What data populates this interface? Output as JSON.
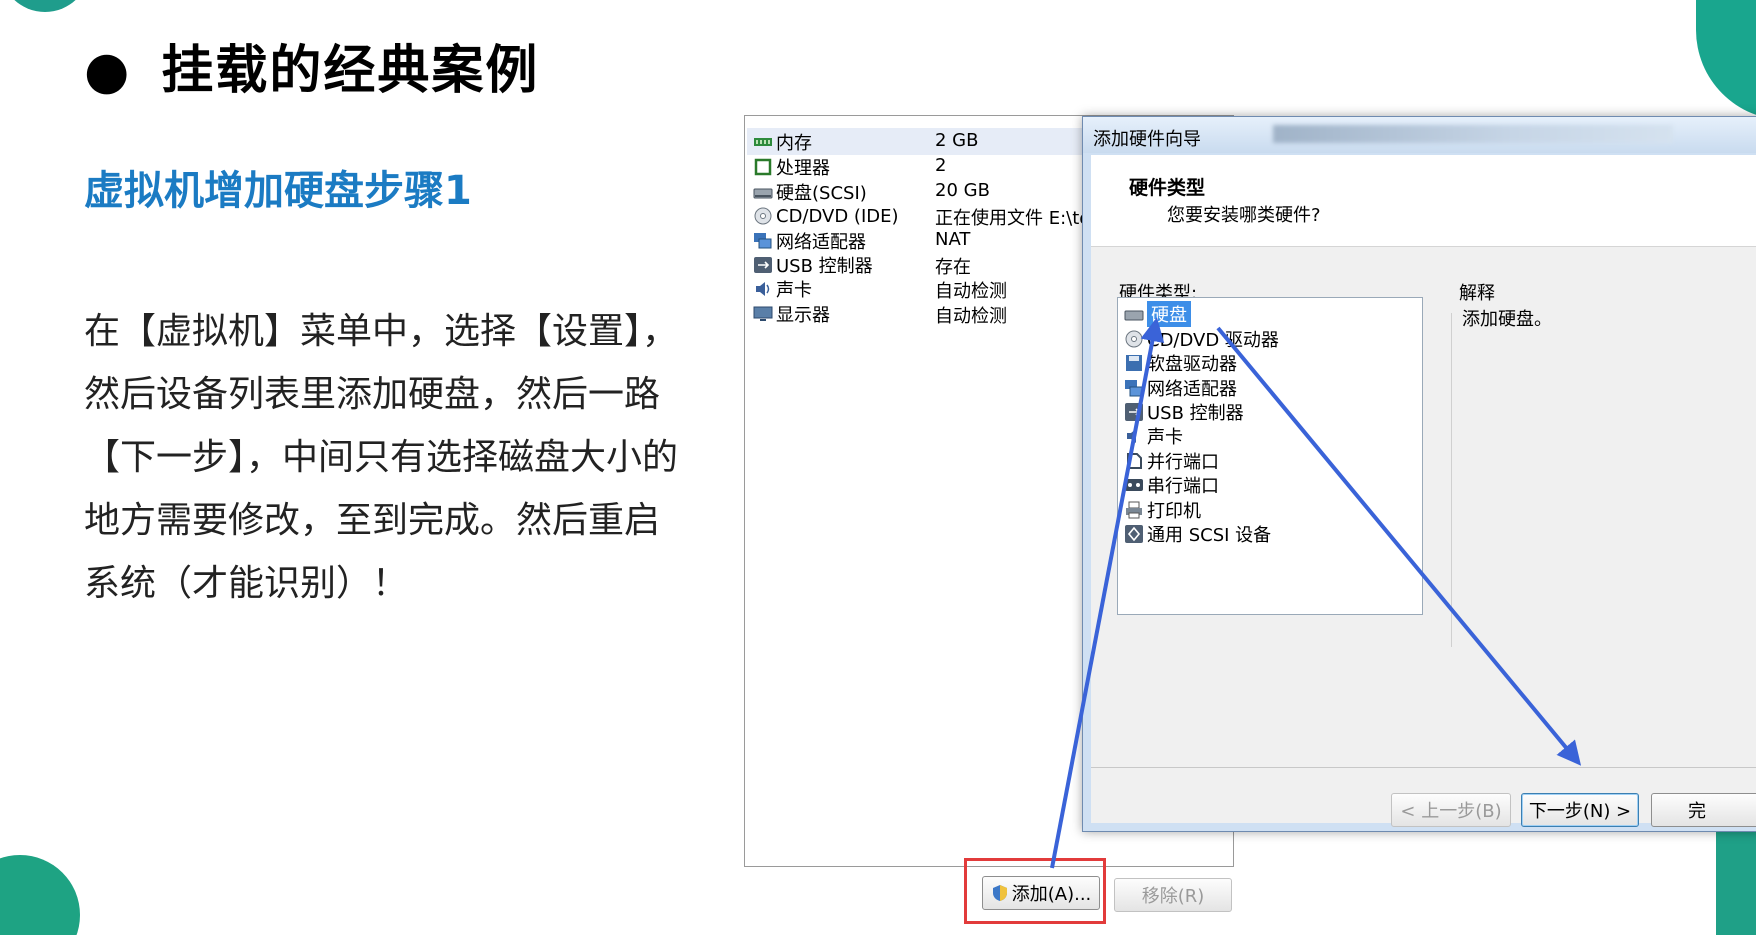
{
  "slide": {
    "title": "挂载的经典案例",
    "bullet": "●",
    "subtitle": "虚拟机增加硬盘步骤1",
    "body": "在【虚拟机】菜单中，选择【设置】，然后设备列表里添加硬盘，然后一路【下一步】，中间只有选择磁盘大小的地方需要修改，至到完成。然后重启系统（才能识别）！"
  },
  "settings": {
    "devices": [
      {
        "name": "内存",
        "value": "2 GB",
        "icon": "memory-icon"
      },
      {
        "name": "处理器",
        "value": "2",
        "icon": "cpu-icon"
      },
      {
        "name": "硬盘(SCSI)",
        "value": "20 GB",
        "icon": "harddisk-icon"
      },
      {
        "name": "CD/DVD (IDE)",
        "value": "正在使用文件 E:\\too",
        "icon": "cdrom-icon"
      },
      {
        "name": "网络适配器",
        "value": "NAT",
        "icon": "network-icon"
      },
      {
        "name": "USB 控制器",
        "value": "存在",
        "icon": "usb-icon"
      },
      {
        "name": "声卡",
        "value": "自动检测",
        "icon": "sound-icon"
      },
      {
        "name": "显示器",
        "value": "自动检测",
        "icon": "display-icon"
      }
    ],
    "add_button": "添加(A)...",
    "remove_button": "移除(R)"
  },
  "wizard": {
    "title": "添加硬件向导",
    "header_title": "硬件类型",
    "header_subtitle": "您要安装哪类硬件?",
    "list_label": "硬件类型:",
    "explain_label": "解释",
    "explain_text": "添加硬盘。",
    "items": [
      {
        "label": "硬盘",
        "icon": "harddisk-icon"
      },
      {
        "label": "CD/DVD 驱动器",
        "icon": "cdrom-icon"
      },
      {
        "label": "软盘驱动器",
        "icon": "floppy-icon"
      },
      {
        "label": "网络适配器",
        "icon": "network-icon"
      },
      {
        "label": "USB 控制器",
        "icon": "usb-icon"
      },
      {
        "label": "声卡",
        "icon": "sound-icon"
      },
      {
        "label": "并行端口",
        "icon": "parallel-port-icon"
      },
      {
        "label": "串行端口",
        "icon": "serial-port-icon"
      },
      {
        "label": "打印机",
        "icon": "printer-icon"
      },
      {
        "label": "通用 SCSI 设备",
        "icon": "scsi-icon"
      }
    ],
    "selected_index": 0,
    "back_button": "< 上一步(B)",
    "next_button": "下一步(N) >",
    "finish_button_partial": "完"
  },
  "colors": {
    "accent_title": "#1b7bc3",
    "arrow": "#3a63d8",
    "highlight_box": "#e23b3b",
    "decoration": "#1ea383"
  }
}
